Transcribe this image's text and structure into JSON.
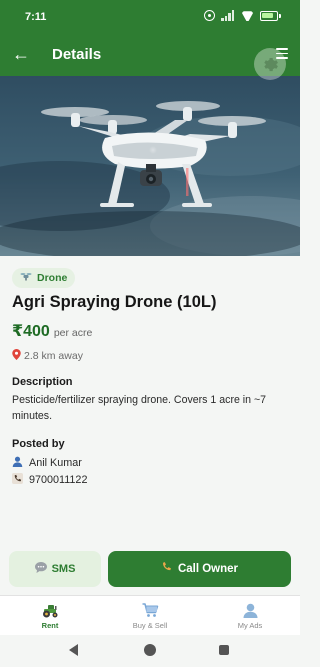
{
  "status_bar": {
    "time": "7:11"
  },
  "app_bar": {
    "title": "Details"
  },
  "listing": {
    "category": "Drone",
    "title": "Agri Spraying Drone (10L)",
    "price": "₹400",
    "price_unit": "per acre",
    "distance": "2.8 km away",
    "description_heading": "Description",
    "description": "Pesticide/fertilizer spraying drone. Covers 1 acre in ~7 minutes.",
    "posted_by_heading": "Posted by",
    "owner_name": "Anil Kumar",
    "owner_phone": "9700011122"
  },
  "actions": {
    "sms_label": "SMS",
    "call_label": "Call Owner"
  },
  "bottom_nav": {
    "items": [
      {
        "label": "Rent"
      },
      {
        "label": "Buy & Sell"
      },
      {
        "label": "My Ads"
      }
    ]
  },
  "colors": {
    "primary": "#2e7d32",
    "chip_bg": "#e6f1e3",
    "price": "#1e6b24"
  },
  "icons": [
    "back-arrow-icon",
    "menu-icon",
    "settings-gear-icon",
    "drone-icon",
    "location-pin-icon",
    "person-icon",
    "phone-icon",
    "sms-icon",
    "call-icon",
    "tractor-icon",
    "cart-icon",
    "user-icon"
  ]
}
